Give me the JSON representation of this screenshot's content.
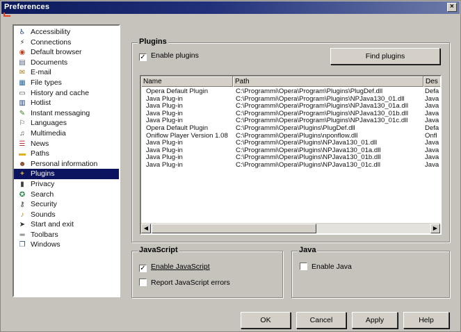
{
  "window": {
    "title": "Preferences",
    "close_glyph": "×"
  },
  "sidebar": {
    "items": [
      {
        "label": "Accessibility",
        "icon": "accessibility-icon",
        "glyph": "♿",
        "color": "#2a4a8a"
      },
      {
        "label": "Connections",
        "icon": "connections-icon",
        "glyph": "⚡",
        "color": "#303030"
      },
      {
        "label": "Default browser",
        "icon": "default-browser-icon",
        "glyph": "◉",
        "color": "#c04020"
      },
      {
        "label": "Documents",
        "icon": "documents-icon",
        "glyph": "▤",
        "color": "#506080"
      },
      {
        "label": "E-mail",
        "icon": "email-icon",
        "glyph": "✉",
        "color": "#a07820"
      },
      {
        "label": "File types",
        "icon": "file-types-icon",
        "glyph": "▦",
        "color": "#2a6a9a"
      },
      {
        "label": "History and cache",
        "icon": "history-icon",
        "glyph": "▭",
        "color": "#404040"
      },
      {
        "label": "Hotlist",
        "icon": "hotlist-icon",
        "glyph": "▥",
        "color": "#1a3a70"
      },
      {
        "label": "Instant messaging",
        "icon": "instant-messaging-icon",
        "glyph": "✎",
        "color": "#3a7a20"
      },
      {
        "label": "Languages",
        "icon": "languages-icon",
        "glyph": "⚐",
        "color": "#404040"
      },
      {
        "label": "Multimedia",
        "icon": "multimedia-icon",
        "glyph": "♫",
        "color": "#404040"
      },
      {
        "label": "News",
        "icon": "news-icon",
        "glyph": "☰",
        "color": "#c03030"
      },
      {
        "label": "Paths",
        "icon": "paths-icon",
        "glyph": "▬",
        "color": "#e0b020"
      },
      {
        "label": "Personal information",
        "icon": "personal-info-icon",
        "glyph": "☻",
        "color": "#804020"
      },
      {
        "label": "Plugins",
        "icon": "plugins-icon",
        "glyph": "✦",
        "color": "#c0a040"
      },
      {
        "label": "Privacy",
        "icon": "privacy-icon",
        "glyph": "▮",
        "color": "#404040"
      },
      {
        "label": "Search",
        "icon": "search-icon",
        "glyph": "✪",
        "color": "#208040"
      },
      {
        "label": "Security",
        "icon": "security-icon",
        "glyph": "⚷",
        "color": "#303030"
      },
      {
        "label": "Sounds",
        "icon": "sounds-icon",
        "glyph": "♪",
        "color": "#b08020"
      },
      {
        "label": "Start and exit",
        "icon": "start-exit-icon",
        "glyph": "➤",
        "color": "#303030"
      },
      {
        "label": "Toolbars",
        "icon": "toolbars-icon",
        "glyph": "═",
        "color": "#303030"
      },
      {
        "label": "Windows",
        "icon": "windows-icon",
        "glyph": "❐",
        "color": "#2a4a8a"
      }
    ],
    "selected": "Plugins"
  },
  "plugins": {
    "group_title": "Plugins",
    "enable_label": "Enable plugins",
    "enable_checked": true,
    "find_button": "Find plugins",
    "columns": [
      "Name",
      "Path",
      "Des"
    ],
    "rows": [
      {
        "name": "Opera Default Plugin",
        "path": "C:\\Programmi\\Opera\\Program\\Plugins\\PlugDef.dll",
        "desc": "Defa"
      },
      {
        "name": "Java Plug-in",
        "path": "C:\\Programmi\\Opera\\Program\\Plugins\\NPJava130_01.dll",
        "desc": "Java"
      },
      {
        "name": "Java Plug-in",
        "path": "C:\\Programmi\\Opera\\Program\\Plugins\\NPJava130_01a.dll",
        "desc": "Java"
      },
      {
        "name": "Java Plug-in",
        "path": "C:\\Programmi\\Opera\\Program\\Plugins\\NPJava130_01b.dll",
        "desc": "Java"
      },
      {
        "name": "Java Plug-in",
        "path": "C:\\Programmi\\Opera\\Program\\Plugins\\NPJava130_01c.dll",
        "desc": "Java"
      },
      {
        "name": "Opera Default Plugin",
        "path": "C:\\Programmi\\Opera\\Plugins\\PlugDef.dll",
        "desc": "Defa"
      },
      {
        "name": "Oniflow Player Version 1.08",
        "path": "C:\\Programmi\\Opera\\Plugins\\nponflow.dll",
        "desc": "Onfl"
      },
      {
        "name": "Java Plug-in",
        "path": "C:\\Programmi\\Opera\\Plugins\\NPJava130_01.dll",
        "desc": "Java"
      },
      {
        "name": "Java Plug-in",
        "path": "C:\\Programmi\\Opera\\Plugins\\NPJava130_01a.dll",
        "desc": "Java"
      },
      {
        "name": "Java Plug-in",
        "path": "C:\\Programmi\\Opera\\Plugins\\NPJava130_01b.dll",
        "desc": "Java"
      },
      {
        "name": "Java Plug-in",
        "path": "C:\\Programmi\\Opera\\Plugins\\NPJava130_01c.dll",
        "desc": "Java"
      }
    ],
    "scroll_left": "◀",
    "scroll_right": "▶"
  },
  "javascript": {
    "group_title": "JavaScript",
    "enable_label": "Enable JavaScript",
    "enable_checked": true,
    "report_label": "Report JavaScript errors",
    "report_checked": false
  },
  "java": {
    "group_title": "Java",
    "enable_label": "Enable Java",
    "enable_checked": false
  },
  "buttons": {
    "ok": "OK",
    "cancel": "Cancel",
    "apply": "Apply",
    "help": "Help"
  },
  "check_glyph": "✓"
}
